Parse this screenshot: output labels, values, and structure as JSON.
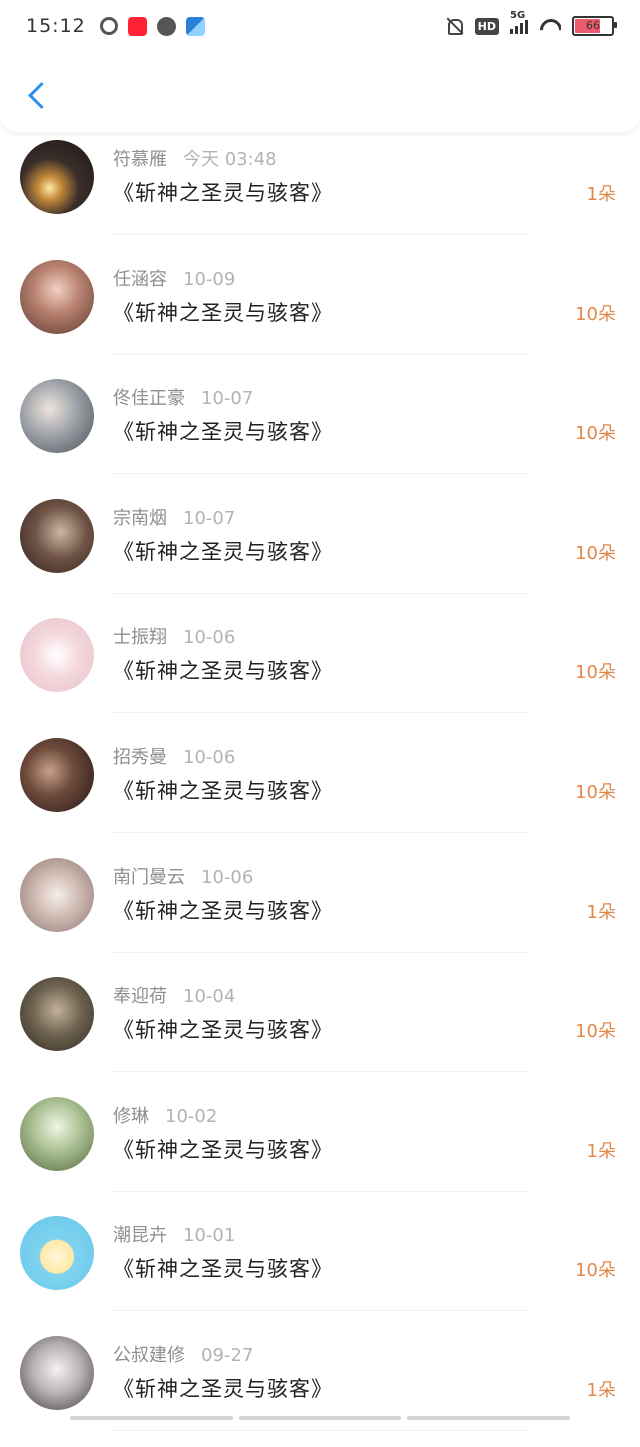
{
  "status_bar": {
    "time": "15:12",
    "network": "5G",
    "hd_label": "HD",
    "battery": "66",
    "battery_color": "#ec5b6c"
  },
  "colors": {
    "accent": "#2a8ef0",
    "count": "#e2884a",
    "name": "#8f8f8f"
  },
  "rows": [
    {
      "name": "符慕雁",
      "date": "今天 03:48",
      "title": "《斩神之圣灵与骇客》",
      "count": "1朵"
    },
    {
      "name": "任涵容",
      "date": "10-09",
      "title": "《斩神之圣灵与骇客》",
      "count": "10朵"
    },
    {
      "name": "佟佳正豪",
      "date": "10-07",
      "title": "《斩神之圣灵与骇客》",
      "count": "10朵"
    },
    {
      "name": "宗南烟",
      "date": "10-07",
      "title": "《斩神之圣灵与骇客》",
      "count": "10朵"
    },
    {
      "name": "士振翔",
      "date": "10-06",
      "title": "《斩神之圣灵与骇客》",
      "count": "10朵"
    },
    {
      "name": "招秀曼",
      "date": "10-06",
      "title": "《斩神之圣灵与骇客》",
      "count": "10朵"
    },
    {
      "name": "南门曼云",
      "date": "10-06",
      "title": "《斩神之圣灵与骇客》",
      "count": "1朵"
    },
    {
      "name": "奉迎荷",
      "date": "10-04",
      "title": "《斩神之圣灵与骇客》",
      "count": "10朵"
    },
    {
      "name": "修琳",
      "date": "10-02",
      "title": "《斩神之圣灵与骇客》",
      "count": "1朵"
    },
    {
      "name": "潮昆卉",
      "date": "10-01",
      "title": "《斩神之圣灵与骇客》",
      "count": "10朵"
    },
    {
      "name": "公叔建修",
      "date": "09-27",
      "title": "《斩神之圣灵与骇客》",
      "count": "1朵"
    }
  ]
}
